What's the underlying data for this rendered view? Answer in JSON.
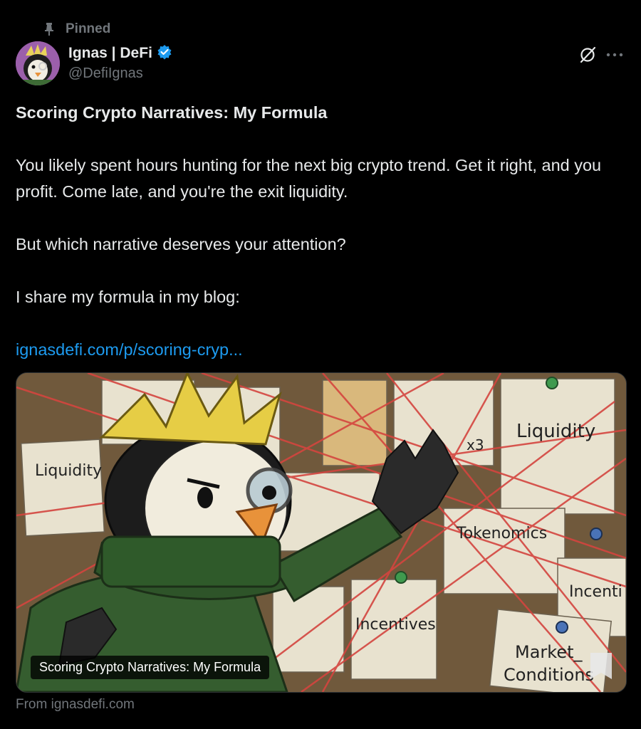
{
  "pinned": {
    "label": "Pinned"
  },
  "author": {
    "name": "Ignas | DeFi",
    "handle": "@DefiIgnas",
    "verified": true
  },
  "post": {
    "title": "Scoring Crypto Narratives: My Formula",
    "paragraph1": "You likely spent hours hunting for the next big crypto trend. Get it right, and you profit. Come late, and you're the exit liquidity.",
    "paragraph2": "But which narrative deserves your attention?",
    "paragraph3": "I share my formula in my blog:",
    "link": "ignasdefi.com/p/scoring-cryp..."
  },
  "card": {
    "caption": "Scoring Crypto Narratives: My Formula",
    "notes": {
      "liquidity_left": "Liquidity",
      "liquidity_right": "Liquidity",
      "x3": "x3",
      "tokenomics": "Tokenomics",
      "incentives": "Incentives",
      "incenti": "Incenti",
      "market_line1": "Market_",
      "market_line2": "Conditions"
    }
  },
  "source": {
    "label": "From ignasdefi.com"
  },
  "colors": {
    "accent": "#1d9bf0",
    "muted": "#71767b",
    "background": "#000000"
  }
}
